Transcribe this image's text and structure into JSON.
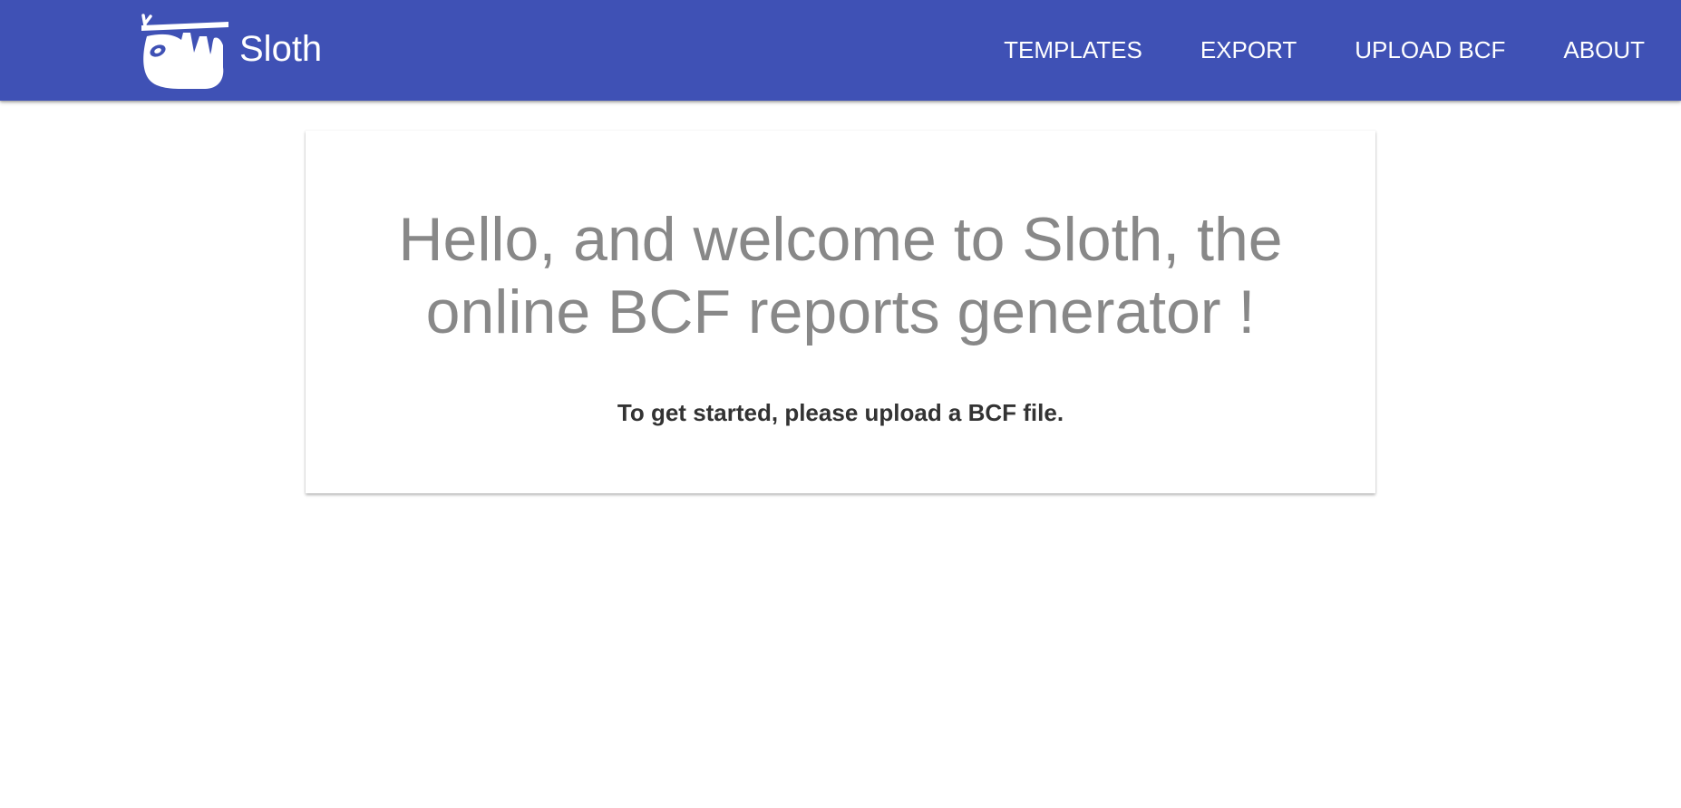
{
  "colors": {
    "navbar_background": "#3f51b5",
    "navbar_text": "#ffffff",
    "title_text": "#888888",
    "instruction_text": "#333333",
    "page_background": "#ffffff"
  },
  "navbar": {
    "brand": {
      "logo_icon": "sloth-icon",
      "name": "Sloth"
    },
    "links": [
      {
        "label": "TEMPLATES"
      },
      {
        "label": "EXPORT"
      },
      {
        "label": "UPLOAD BCF"
      },
      {
        "label": "ABOUT"
      }
    ]
  },
  "welcome_card": {
    "title_lines": [
      "Hello, and welcome to Sloth, the",
      "online BCF reports generator !"
    ],
    "instruction": "To get started, please upload a BCF file."
  }
}
